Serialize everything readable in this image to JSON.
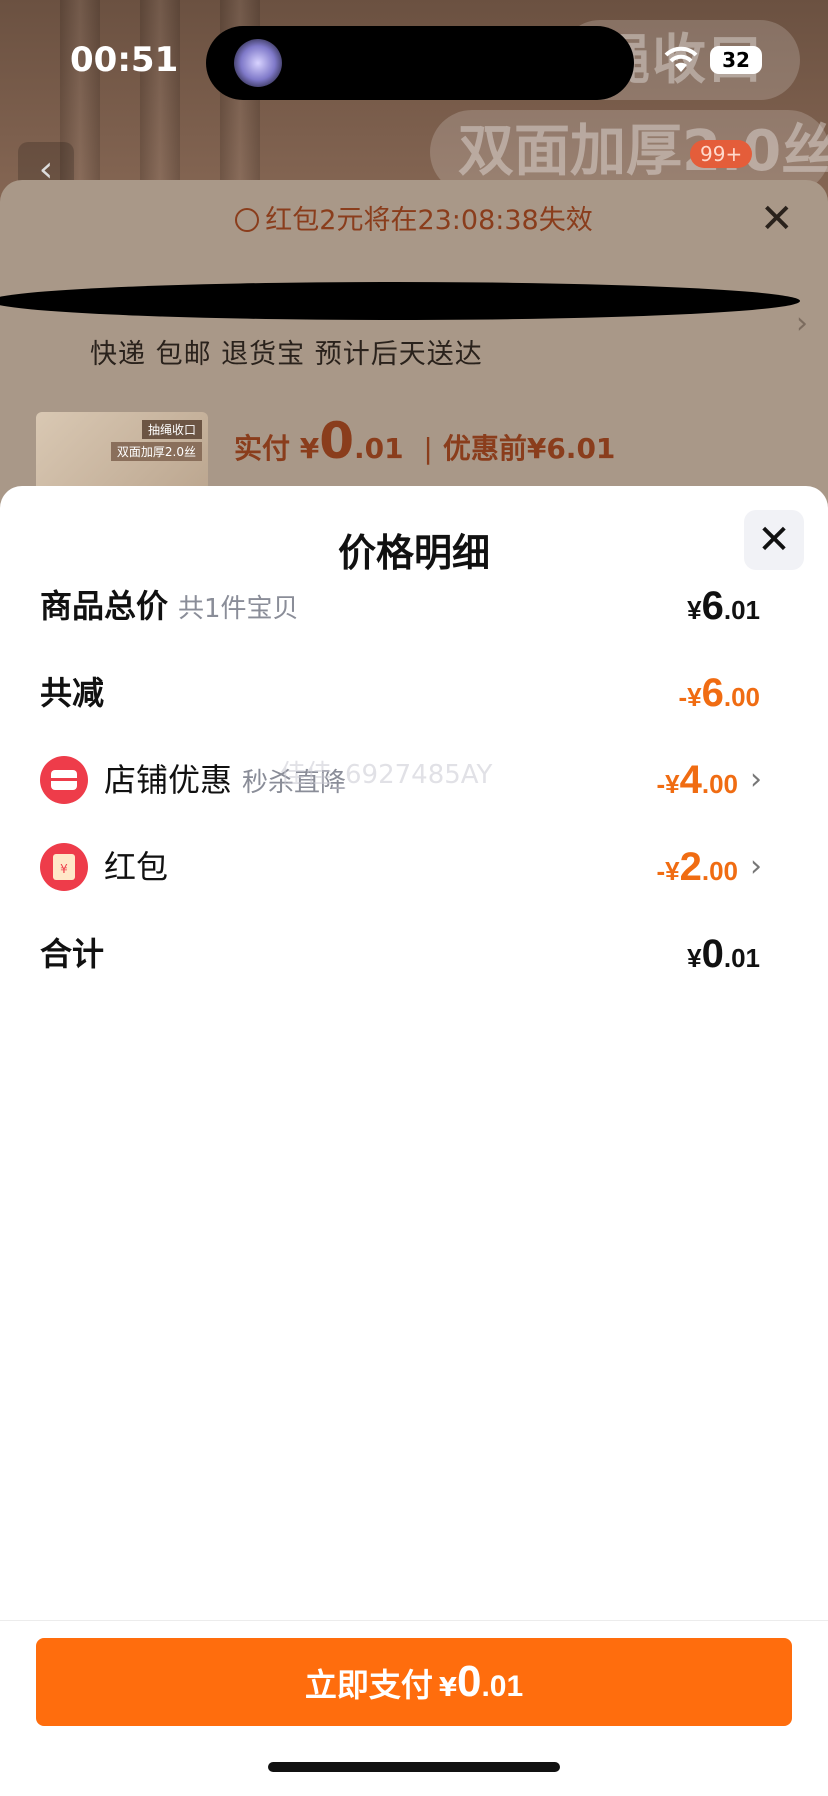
{
  "status_bar": {
    "time": "00:51",
    "battery": "32"
  },
  "background": {
    "banner_top": "绳收口",
    "banner_main": "双面加厚2.0丝",
    "cart_badge": "99+"
  },
  "checkout_sheet": {
    "notice": "红包2元将在23:08:38失效",
    "shipping": "快递 包邮 退货宝 预计后天送达",
    "thumb_tag1": "抽绳收口",
    "thumb_tag2": "双面加厚2.0丝",
    "paid_label": "实付",
    "paid_currency": "¥",
    "paid_int": "0",
    "paid_dec": ".01",
    "before_label": "优惠前¥6.01"
  },
  "modal": {
    "title": "价格明细",
    "watermark": "佳佳_6927485AY",
    "rows": {
      "subtotal": {
        "label": "商品总价",
        "sub": "共1件宝贝",
        "cur": "¥",
        "int": "6",
        "dec": ".01"
      },
      "reduced": {
        "label": "共减",
        "cur": "-¥",
        "int": "6",
        "dec": ".00"
      },
      "shop_discount": {
        "label": "店铺优惠",
        "sub": "秒杀直降",
        "cur": "-¥",
        "int": "4",
        "dec": ".00",
        "icon": "shop-icon"
      },
      "red_packet": {
        "label": "红包",
        "cur": "-¥",
        "int": "2",
        "dec": ".00",
        "icon": "red-packet-icon"
      },
      "total": {
        "label": "合计",
        "cur": "¥",
        "int": "0",
        "dec": ".01"
      }
    },
    "pay_button": {
      "label": "立即支付",
      "cur": "¥",
      "int": "0",
      "dec": ".01"
    }
  },
  "colors": {
    "accent": "#ff6d0d",
    "discount": "#f06c12",
    "shop_icon": "#ee3c4a"
  }
}
